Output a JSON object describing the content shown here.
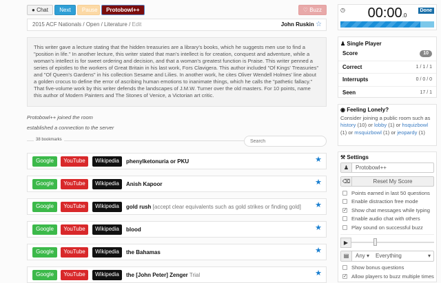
{
  "toolbar": {
    "chat": "Chat",
    "next": "Next",
    "pause": "Pause",
    "room": "Protobowl++",
    "buzz": "Buzz"
  },
  "breadcrumb": {
    "path": "2015 ACF Nationals / Open / Literature / ",
    "edit": "Edit",
    "answer": "John Ruskin"
  },
  "question": "This writer gave a lecture stating that the hidden treasuries are a library's books, which he suggests men use to find a \"position in life.\" In another lecture, this writer stated that man's intellect is for creation, conquest and adventure, while a woman's intellect is for sweet ordering and decision, and that a woman's greatest function is Praise. This writer penned a series of epistles to the workers of Great Britain in his last work, Fors Clavigera. This author included \"Of Kings' Treasuries\" and \"Of Queen's Gardens\" in his collection Sesame and Lilies. In another work, he cites Oliver Wendell Holmes' line about a golden crocus to define the error of ascribing human emotions to inanimate things, which he calls the \"pathetic fallacy.\" That five-volume work by this writer defends the landscapes of J.M.W. Turner over the old masters. For 10 points, name this author of Modern Painters and The Stones of Venice, a Victorian art critic.",
  "log": [
    "Protobowl++ joined the room",
    "established a connection to the server"
  ],
  "bookmarks": {
    "count": "38 bookmarks",
    "search_placeholder": "Search",
    "google": "Google",
    "youtube": "YouTube",
    "wikipedia": "Wikipedia",
    "items": [
      {
        "a": "phenylketonuria or PKU",
        "n": ""
      },
      {
        "a": "Anish Kapoor",
        "n": ""
      },
      {
        "a": "gold rush",
        "n": " [accept clear equivalents such as gold strikes or finding gold]"
      },
      {
        "a": "blood",
        "n": ""
      },
      {
        "a": "the Bahamas",
        "n": ""
      },
      {
        "a": "the [John Peter] Zenger",
        "n": " Trial"
      }
    ]
  },
  "timer": {
    "main": "00:00",
    "frac": ".0",
    "done": "Done",
    "progress_percent": 85
  },
  "player": {
    "title": "Single Player",
    "score_label": "Score",
    "score": "10",
    "correct_label": "Correct",
    "correct": "1 / 1 / 1",
    "interrupts_label": "Interrupts",
    "interrupts": "0 / 0 / 0",
    "seen_label": "Seen",
    "seen": "17 / 1"
  },
  "lonely": {
    "title": "Feeling Lonely?",
    "text": "Consider joining a public room such as",
    "rooms": [
      {
        "name": "history",
        "count": " (10) or "
      },
      {
        "name": "lobby",
        "count": " (1) or "
      },
      {
        "name": "hsquizbowl",
        "count": " (1) or "
      },
      {
        "name": "msquizbowl",
        "count": " (1) or "
      },
      {
        "name": "jeopardy",
        "count": " (1)"
      }
    ]
  },
  "settings": {
    "title": "Settings",
    "name": "Protobowl++",
    "reset": "Reset My Score",
    "speed_percent": 27,
    "category": "Any",
    "difficulty": "Everything",
    "checks": [
      {
        "label": "Points earned in last 50 questions",
        "on": false
      },
      {
        "label": "Enable distraction free mode",
        "on": false
      },
      {
        "label": "Show chat messages while typing",
        "on": true
      },
      {
        "label": "Enable audio chat with others",
        "on": false
      },
      {
        "label": "Play sound on successful buzz",
        "on": false
      }
    ],
    "checks2": [
      {
        "label": "Show bonus questions",
        "on": false
      },
      {
        "label": "Allow players to buzz multiple times",
        "on": true
      }
    ]
  },
  "colors": {
    "next": "#2f9fd6",
    "room": "#7a0d0d",
    "google": "#3cb94a",
    "youtube": "#d8282a",
    "timer_bar": "#1a8fd8"
  }
}
